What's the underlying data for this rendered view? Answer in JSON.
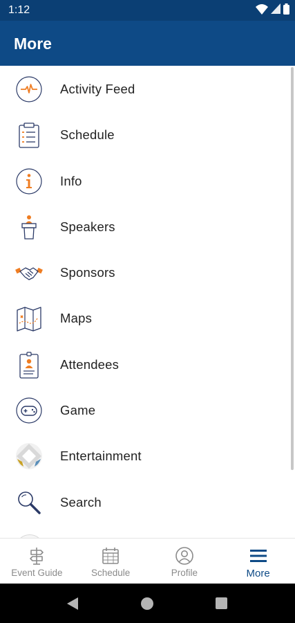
{
  "status_bar": {
    "time": "1:12",
    "icons": [
      "wifi-icon",
      "signal-icon",
      "battery-icon"
    ]
  },
  "header": {
    "title": "More"
  },
  "menu": {
    "items": [
      {
        "label": "Activity Feed",
        "icon": "activity-icon"
      },
      {
        "label": "Schedule",
        "icon": "clipboard-icon"
      },
      {
        "label": "Info",
        "icon": "info-icon"
      },
      {
        "label": "Speakers",
        "icon": "podium-icon"
      },
      {
        "label": "Sponsors",
        "icon": "handshake-icon"
      },
      {
        "label": "Maps",
        "icon": "map-icon"
      },
      {
        "label": "Attendees",
        "icon": "id-badge-icon"
      },
      {
        "label": "Game",
        "icon": "gamepad-icon"
      },
      {
        "label": "Entertainment",
        "icon": "entertainment-icon"
      },
      {
        "label": "Search",
        "icon": "search-icon"
      }
    ]
  },
  "bottom_nav": {
    "tabs": [
      {
        "label": "Event Guide",
        "icon": "signpost-icon",
        "active": false
      },
      {
        "label": "Schedule",
        "icon": "calendar-icon",
        "active": false
      },
      {
        "label": "Profile",
        "icon": "profile-icon",
        "active": false
      },
      {
        "label": "More",
        "icon": "hamburger-icon",
        "active": true
      }
    ]
  },
  "system_nav": [
    "back-icon",
    "home-icon",
    "recents-icon"
  ],
  "colors": {
    "primary": "#0e4a86",
    "status_bar": "#0b3f74",
    "icon_navy": "#2b3a67",
    "icon_orange": "#ef7d22",
    "inactive_gray": "#8a8a8a"
  }
}
